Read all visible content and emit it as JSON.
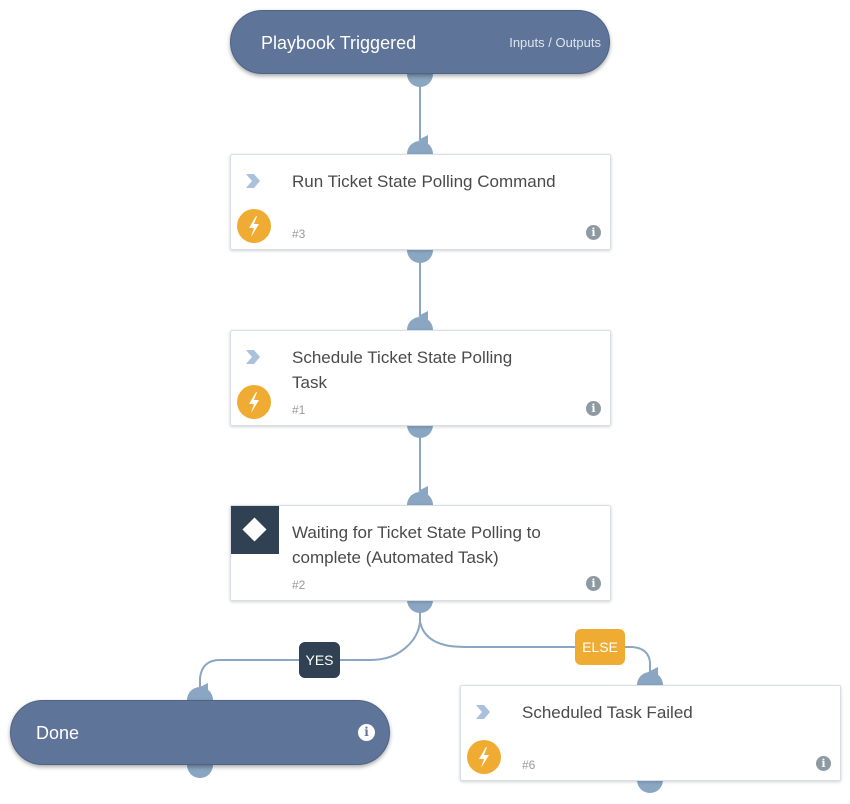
{
  "colors": {
    "pill": "#5f7499",
    "connector": "#8aa6c2",
    "yes_badge": "#2f4152",
    "else_badge": "#f0ac32",
    "bolt": "#f0ac32"
  },
  "start_node": {
    "title": "Playbook Triggered",
    "io_link": "Inputs / Outputs"
  },
  "tasks": [
    {
      "id": "task-3",
      "title": "Run Ticket State Polling Command",
      "number": "#3",
      "type_icon": "chevron-right-icon",
      "automation_icon": "lightning-bolt-icon"
    },
    {
      "id": "task-1",
      "title": "Schedule Ticket State Polling Task",
      "number": "#1",
      "type_icon": "chevron-right-icon",
      "automation_icon": "lightning-bolt-icon"
    },
    {
      "id": "task-2",
      "title": "Waiting for Ticket State Polling to complete (Automated Task)",
      "number": "#2",
      "type_icon": "diamond-condition-icon"
    },
    {
      "id": "task-6",
      "title": "Scheduled Task Failed",
      "number": "#6",
      "type_icon": "chevron-right-icon",
      "automation_icon": "lightning-bolt-icon"
    }
  ],
  "branches": {
    "yes": "YES",
    "else": "ELSE"
  },
  "end_node": {
    "title": "Done"
  },
  "info_glyph": "i"
}
